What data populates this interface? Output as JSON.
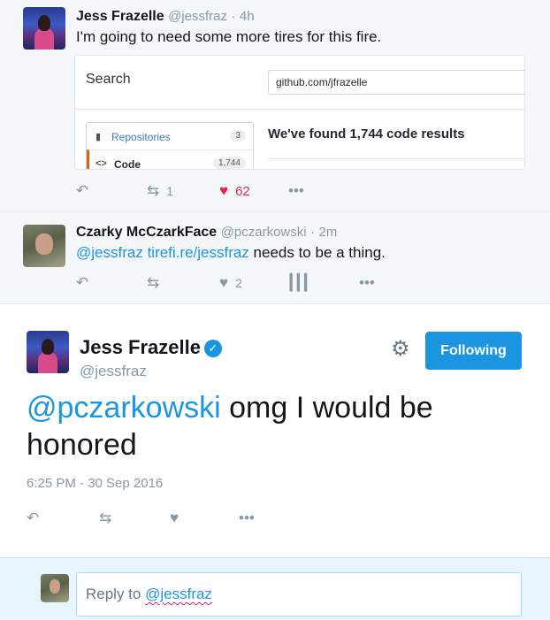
{
  "tweet1": {
    "name": "Jess Frazelle",
    "handle": "@jessfraz",
    "time": "4h",
    "text": "I'm going to need some more tires for this fire.",
    "card": {
      "search_label": "Search",
      "search_value": "github.com/jfrazelle",
      "menu": [
        {
          "label": "Repositories",
          "count": "3",
          "icon": "book-icon"
        },
        {
          "label": "Code",
          "count": "1,744",
          "icon": "code-icon"
        }
      ],
      "result": "We've found 1,744 code results"
    },
    "retweets": "1",
    "likes": "62"
  },
  "tweet2": {
    "name": "Czarky McCzarkFace",
    "handle": "@pczarkowski",
    "time": "2m",
    "mention": "@jessfraz",
    "link": "tirefi.re/jessfraz",
    "text_rest": "needs to be a thing.",
    "likes": "2"
  },
  "main_tweet": {
    "name": "Jess Frazelle",
    "handle": "@jessfraz",
    "follow_label": "Following",
    "mention": "@pczarkowski",
    "text_rest": "omg I would be honored",
    "timestamp": "6:25 PM - 30 Sep 2016"
  },
  "reply": {
    "prefix": "Reply to",
    "mention": "@jessfraz"
  },
  "colors": {
    "accent": "#1b95e0",
    "like": "#e2264d",
    "muted": "#8899a6"
  }
}
